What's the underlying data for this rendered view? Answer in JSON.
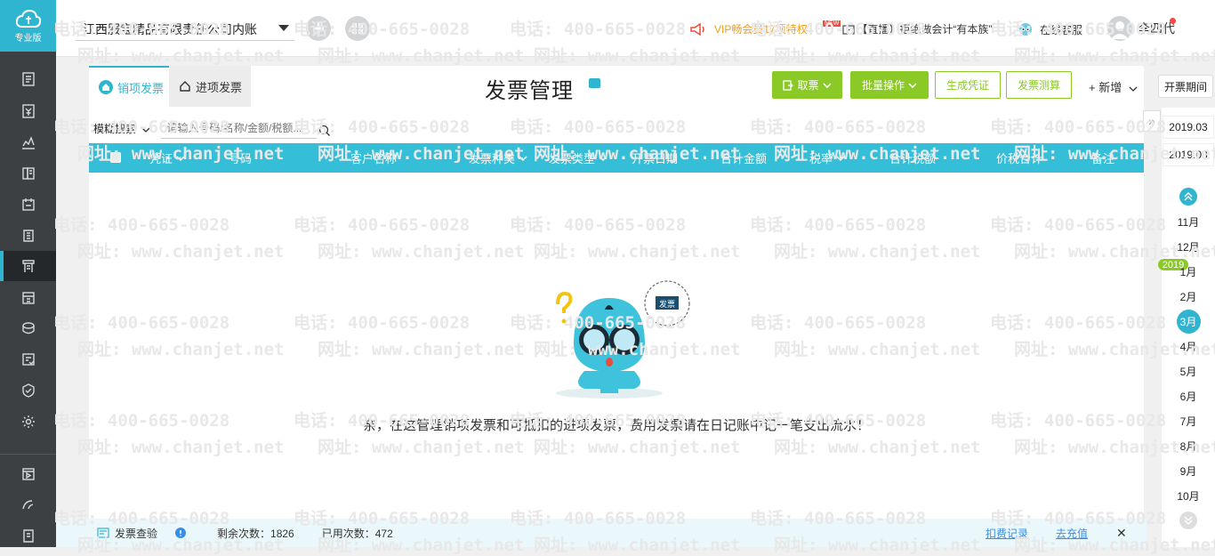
{
  "sidebar": {
    "logo_label": "专业版",
    "icons": [
      "ledger-icon",
      "voucher-icon",
      "report-chart-icon",
      "books-icon",
      "calendar-icon",
      "document-icon",
      "invoice-icon",
      "assets-icon",
      "wallet-icon",
      "checklist-icon",
      "shield-check-icon",
      "settings-icon",
      "video-icon",
      "quickpay-icon",
      "tax-icon"
    ]
  },
  "topbar": {
    "company": "江西服宝精品有限责任公司内账",
    "vip": "VIP畅会员17项特权",
    "live_badge": "NEW",
    "live": "【直播】拒绝做会计“有本族”",
    "service": "在线客服",
    "username": "李四代"
  },
  "tabs": {
    "sales": "销项发票",
    "input": "进项发票"
  },
  "page_title": "发票管理",
  "toolbar": {
    "get_invoice": "取票",
    "batch": "批量操作",
    "generate_voucher": "生成凭证",
    "invoice_calc": "发票测算",
    "add_new": "+ 新增"
  },
  "search": {
    "mode": "模糊搜索",
    "placeholder": "请输入号码/名称/金额/税额..."
  },
  "table": {
    "columns": [
      "凭证",
      "号码",
      "客户名称",
      "发票种类",
      "发票类型",
      "开票日期",
      "合计金额",
      "税率",
      "合计税额",
      "价税合计",
      "备注"
    ]
  },
  "mascot_badge": "发票",
  "empty_message": "亲，在这管理销项发票和可抵扣的进项发票，费用发票请在日记账中记一笔支出流水！",
  "footer": {
    "check": "发票查验",
    "remaining": "剩余次数：1826",
    "used": "已用次数：472",
    "charge_records": "扣费记录",
    "recharge": "去充值",
    "close": "✕"
  },
  "period": {
    "label": "开票期间",
    "start": "2019.03",
    "end": "2019.03",
    "year_badge": "2019",
    "months": [
      "11月",
      "12月",
      "1月",
      "2月",
      "3月",
      "4月",
      "5月",
      "6月",
      "7月",
      "8月",
      "9月",
      "10月"
    ],
    "selected": "3月"
  },
  "watermark": {
    "phone": "电话: 400-665-0028",
    "site": "网址: www.chanjet.net"
  },
  "colors": {
    "accent": "#2fb5cf",
    "green": "#8bc926",
    "sidebar": "#3d4043",
    "vip": "#f39c12"
  }
}
